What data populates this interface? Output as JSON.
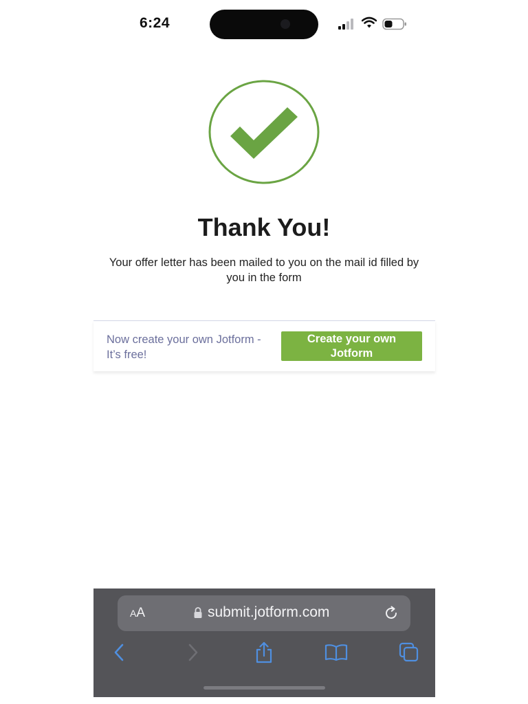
{
  "status_bar": {
    "time": "6:24",
    "icons": [
      "signal-icon",
      "wifi-icon",
      "battery-icon"
    ]
  },
  "confirmation": {
    "icon": "checkmark-circle-icon",
    "title": "Thank You!",
    "message": "Your offer letter has been mailed to you on the mail id filled by you in the form"
  },
  "promo": {
    "text": "Now create your own Jotform - It’s free!",
    "button_label": "Create your own Jotform"
  },
  "browser": {
    "aa_small": "A",
    "aa_large": "A",
    "url": "submit.jotform.com",
    "nav_icons": [
      "back-icon",
      "forward-icon",
      "share-icon",
      "bookmarks-icon",
      "tabs-icon"
    ]
  },
  "colors": {
    "success_green": "#6aa443",
    "button_green": "#7cb342",
    "promo_text": "#6b6f9c",
    "toolbar_bg": "#545458",
    "ios_blue": "#4f8fe0"
  }
}
